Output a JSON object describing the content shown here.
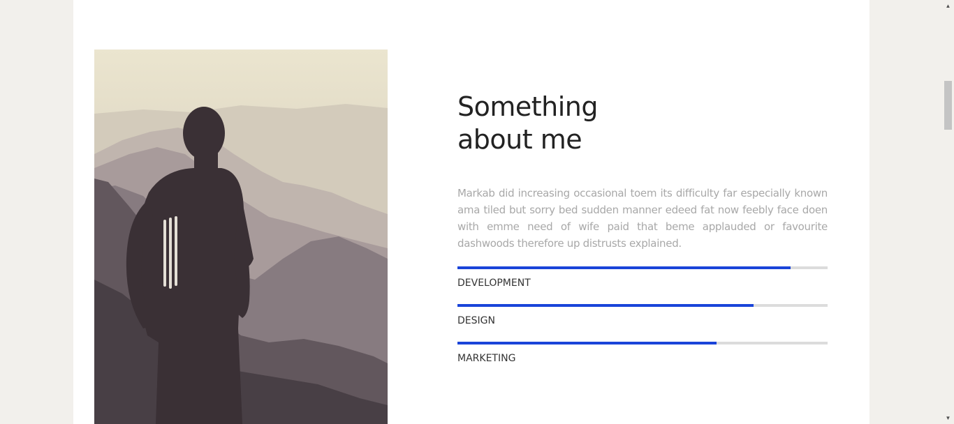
{
  "about": {
    "title_line1": "Something",
    "title_line2": "about me",
    "bio": "Markab did increasing occasional toem its difficulty far especially known ama tiled but sorry bed sudden manner edeed fat now feebly face doen with emme need of wife paid that beme applauded or favourite dashwoods therefore up distrusts explained.",
    "photo": "man-with-backpack-overlooking-misty-mountains-photo"
  },
  "skills": [
    {
      "label": "DEVELOPMENT",
      "level": 0.9
    },
    {
      "label": "DESIGN",
      "level": 0.8
    },
    {
      "label": "MARKETING",
      "level": 0.7
    }
  ],
  "colors": {
    "accent": "#1a44d9",
    "track": "#dcdcdc",
    "page_background": "#f2f0ec"
  },
  "scrollbar": {
    "up_icon": "scroll-up-arrow-icon",
    "down_icon": "scroll-down-arrow-icon",
    "up_glyph": "▲",
    "down_glyph": "▼"
  }
}
